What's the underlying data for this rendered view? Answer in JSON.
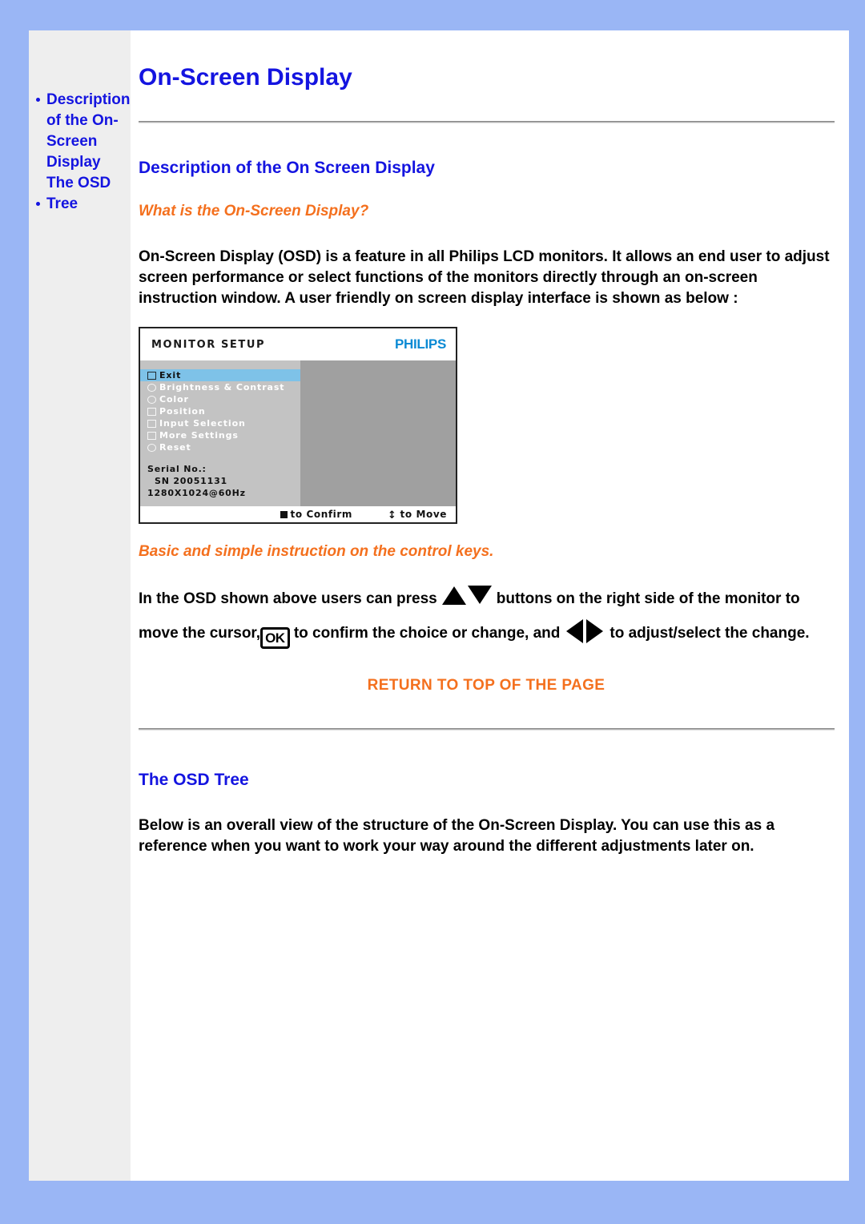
{
  "colors": {
    "page_background": "#9ab6f5",
    "paper": "#ffffff",
    "sidebar_background": "#eeeeee",
    "heading_blue": "#1414e0",
    "accent_orange": "#f4701e",
    "osd_menu_gray": "#c3c3c3",
    "osd_panel_gray": "#a0a0a0",
    "osd_highlight_blue": "#7ec2e8",
    "philips_blue": "#0b8ad4"
  },
  "sidebar": {
    "items": [
      {
        "label": "Description of the On-Screen Display",
        "name": "sidebar-item-description"
      },
      {
        "label": "The OSD Tree",
        "name": "sidebar-item-osd-tree"
      }
    ]
  },
  "main": {
    "page_title": "On-Screen Display",
    "sections": [
      {
        "heading": "Description of the On Screen Display",
        "subheading": "What is the On-Screen Display?",
        "paragraph": "On-Screen Display (OSD) is a feature in all Philips LCD monitors. It allows an end user to adjust screen performance or select functions of the monitors directly through an on-screen instruction window. A user friendly on screen display interface is shown as below :"
      },
      {
        "heading": "The OSD Tree",
        "paragraph": "Below is an overall view of the structure of the On-Screen Display. You can use this as a reference when you want to work your way around the different adjustments later on."
      }
    ],
    "control_keys": {
      "subheading": "Basic and simple instruction on the control keys.",
      "text_1": "In the OSD shown above users can press",
      "text_2": "buttons on the right side of the monitor to move the cursor,",
      "ok_key_label": "OK",
      "text_3": "to confirm the choice or change, and",
      "text_4": "to adjust/select the change.",
      "icons": [
        "triangle-up-icon",
        "triangle-down-icon",
        "triangle-left-icon",
        "triangle-right-icon",
        "ok-key-icon"
      ]
    },
    "return_link": "RETURN TO TOP OF THE PAGE"
  },
  "osd_figure": {
    "title": "MONITOR SETUP",
    "brand": "PHILIPS",
    "menu_items": [
      {
        "label": "Exit",
        "icon": "exit-icon",
        "selected": true
      },
      {
        "label": "Brightness & Contrast",
        "icon": "brightness-icon",
        "selected": false
      },
      {
        "label": "Color",
        "icon": "color-icon",
        "selected": false
      },
      {
        "label": "Position",
        "icon": "position-icon",
        "selected": false
      },
      {
        "label": "Input Selection",
        "icon": "input-icon",
        "selected": false
      },
      {
        "label": "More Settings",
        "icon": "settings-icon",
        "selected": false
      },
      {
        "label": "Reset",
        "icon": "reset-icon",
        "selected": false
      }
    ],
    "serial_label": "Serial No.:",
    "serial_value": "SN 20051131",
    "resolution": "1280X1024@60Hz",
    "footer_confirm": "to Confirm",
    "footer_move": "to Move"
  }
}
